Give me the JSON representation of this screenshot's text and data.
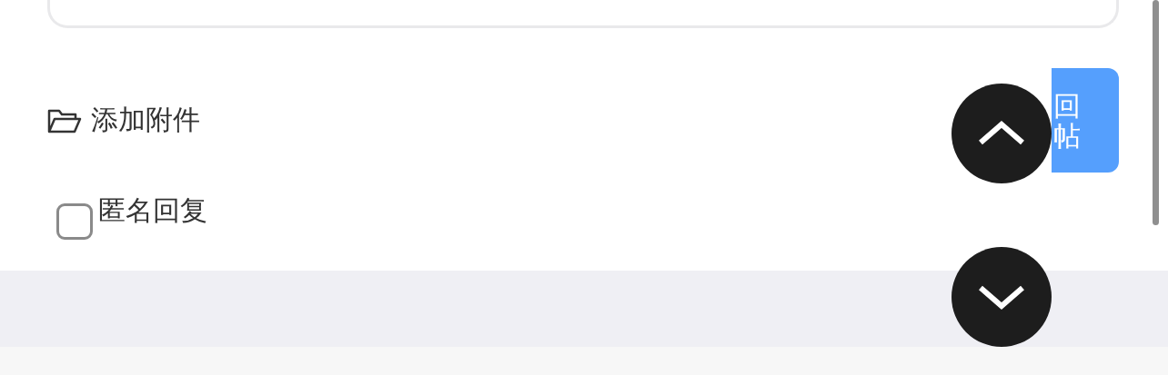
{
  "attach": {
    "label": "添加附件"
  },
  "anonymous": {
    "label": "匿名回复",
    "checked": false
  },
  "reply_button": {
    "label": "回帖"
  }
}
